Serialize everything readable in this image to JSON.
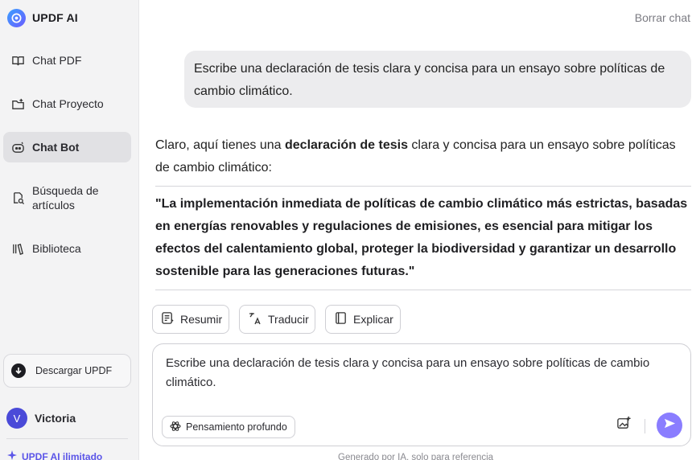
{
  "sidebar": {
    "brand": "UPDF AI",
    "items": [
      {
        "label": "Chat PDF",
        "icon": "book-open-icon"
      },
      {
        "label": "Chat Proyecto",
        "icon": "folder-plus-icon"
      },
      {
        "label": "Chat Bot",
        "icon": "robot-icon",
        "active": true
      },
      {
        "label": "Búsqueda de artículos",
        "icon": "doc-search-icon"
      },
      {
        "label": "Biblioteca",
        "icon": "library-icon"
      }
    ],
    "download_label": "Descargar UPDF",
    "user": {
      "initial": "V",
      "name": "Victoria"
    },
    "unlimited_label": "UPDF AI ilimitado"
  },
  "header": {
    "clear_label": "Borrar chat"
  },
  "chat": {
    "user_message": "Escribe una declaración de tesis clara y concisa para un ensayo sobre políticas de cambio climático.",
    "ai_intro_pre": "Claro, aquí tienes una ",
    "ai_intro_bold": "declaración de tesis",
    "ai_intro_post": " clara y concisa para un ensayo sobre políticas de cambio climático:",
    "thesis": "\"La implementación inmediata de políticas de cambio climático más estrictas, basadas en energías renovables y regulaciones de emisiones, es esencial para mitigar los efectos del calentamiento global, proteger la biodiversidad y garantizar un desarrollo sostenible para las generaciones futuras.\"",
    "actions": [
      {
        "label": "Resumir",
        "icon": "summarize-icon"
      },
      {
        "label": "Traducir",
        "icon": "translate-icon"
      },
      {
        "label": "Explicar",
        "icon": "book-icon"
      }
    ]
  },
  "composer": {
    "value": "Escribe una declaración de tesis clara y concisa para un ensayo sobre políticas de cambio climático.",
    "deep_think_label": "Pensamiento profundo"
  },
  "footer": {
    "disclaimer": "Generado por IA, solo para referencia"
  },
  "colors": {
    "accent": "#8a7dff",
    "active_nav": "#e1e1e4",
    "sidebar_bg": "#f3f3f4"
  }
}
